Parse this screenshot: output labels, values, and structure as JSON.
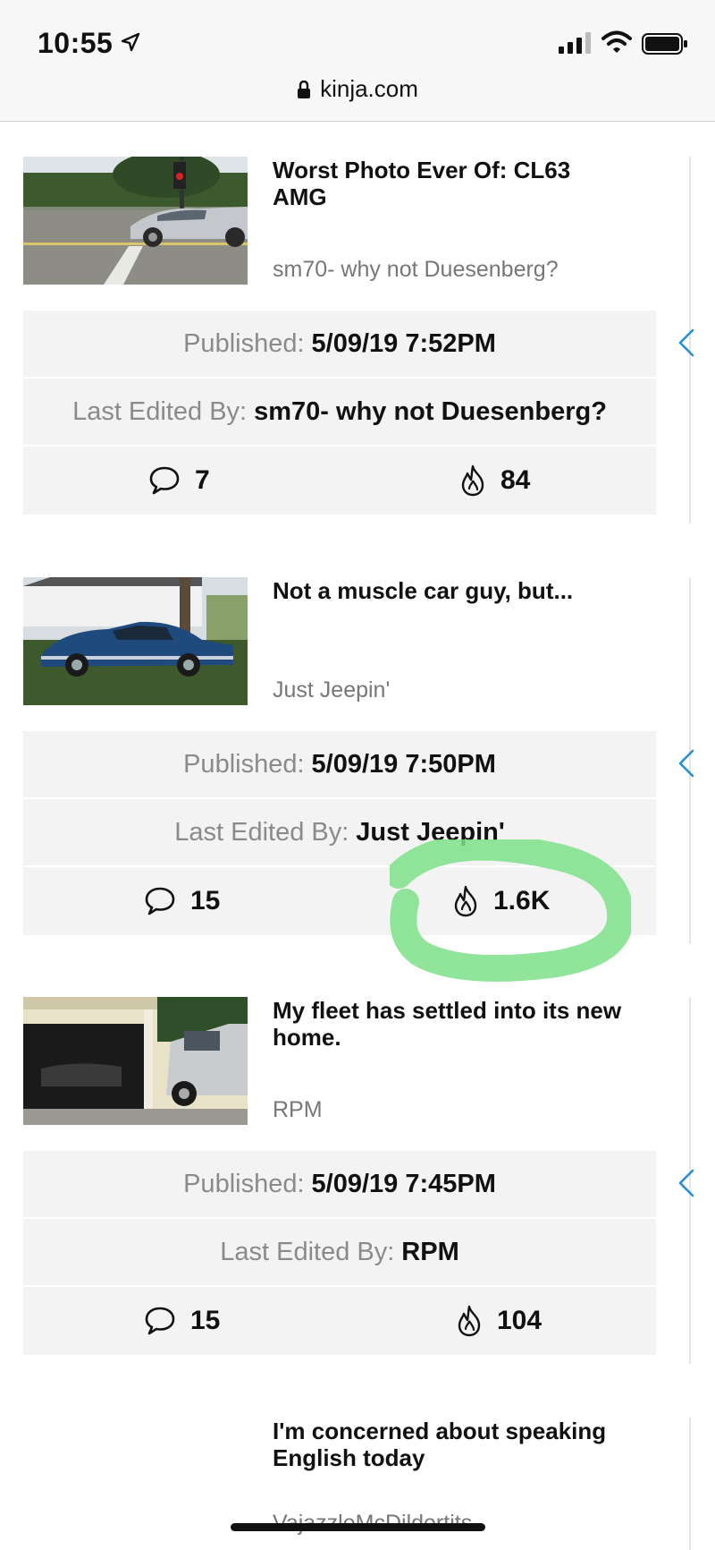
{
  "status_bar": {
    "time": "10:55",
    "url": "kinja.com"
  },
  "labels": {
    "published": "Published:",
    "last_edited_by": "Last Edited By:"
  },
  "posts": [
    {
      "title": "Worst Photo Ever Of: CL63 AMG",
      "author": "sm70- why not Duesenberg?",
      "published": "5/09/19 7:52PM",
      "last_edited_by": "sm70- why not Duesenberg?",
      "comments": "7",
      "likes": "84",
      "thumbnail": "silver-mercedes-coupe-photo"
    },
    {
      "title": "Not a muscle car guy, but...",
      "author": "Just Jeepin'",
      "published": "5/09/19 7:50PM",
      "last_edited_by": "Just Jeepin'",
      "comments": "15",
      "likes": "1.6K",
      "thumbnail": "blue-muscle-car-photo"
    },
    {
      "title": "My fleet has settled into its new home.",
      "author": "RPM",
      "published": "5/09/19 7:45PM",
      "last_edited_by": "RPM",
      "comments": "15",
      "likes": "104",
      "thumbnail": "garage-with-suv-photo"
    },
    {
      "title": "I'm concerned about speaking English today",
      "author": "VajazzleMcDildertits"
    }
  ],
  "colors": {
    "accent_blue": "#2a8fd6",
    "highlight_green": "#7ee08a",
    "meta_background": "#f3f3f3"
  }
}
